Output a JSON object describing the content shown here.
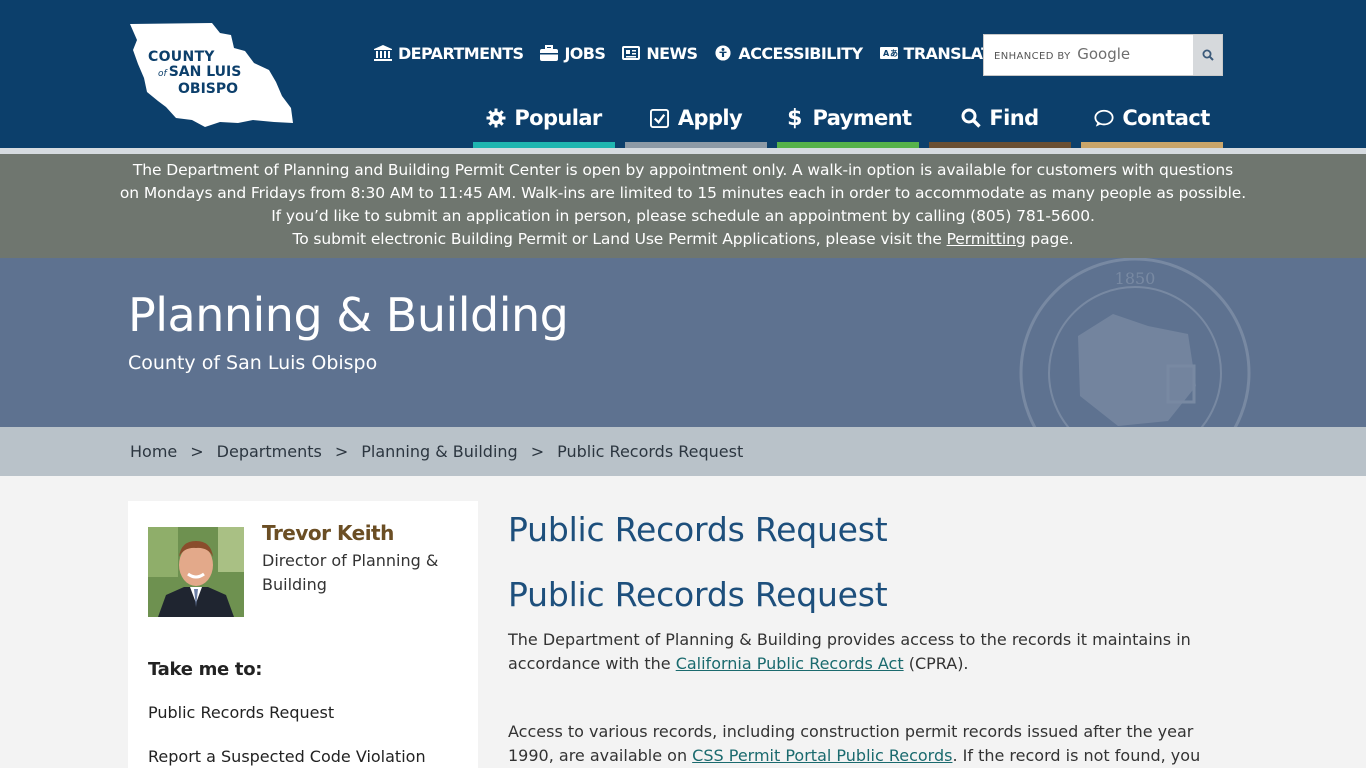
{
  "logo": {
    "line1": "COUNTY",
    "of": "of",
    "line2": "SAN LUIS",
    "line3": "OBISPO"
  },
  "utility_nav": [
    {
      "label": "DEPARTMENTS",
      "icon": "building-icon"
    },
    {
      "label": "JOBS",
      "icon": "briefcase-icon"
    },
    {
      "label": "NEWS",
      "icon": "newspaper-icon"
    },
    {
      "label": "ACCESSIBILITY",
      "icon": "accessibility-icon"
    },
    {
      "label": "TRANSLATE",
      "icon": "translate-icon"
    }
  ],
  "search": {
    "brand_prefix": "ENHANCED BY",
    "brand_name": "Google",
    "placeholder": ""
  },
  "main_nav": [
    {
      "label": "Popular",
      "icon": "gear-icon",
      "color": "#1fb5b0"
    },
    {
      "label": "Apply",
      "icon": "checkbox-icon",
      "color": "#8d9aa6"
    },
    {
      "label": "Payment",
      "icon": "dollar-icon",
      "color": "#56b24a"
    },
    {
      "label": "Find",
      "icon": "search-icon",
      "color": "#6a4f33"
    },
    {
      "label": "Contact",
      "icon": "chat-icon",
      "color": "#c9a56a"
    }
  ],
  "alert": {
    "line1": "The Department of Planning and Building Permit Center is open by appointment only. A walk-in option is available for customers with questions",
    "line2": "on Mondays and Fridays from 8:30 AM to 11:45 AM. Walk-ins are limited to 15 minutes each in order to accommodate as many people as possible.",
    "line3": "If you’d like to submit an application in person, please schedule an appointment by calling (805) 781-5600.",
    "line4_pre": "To submit electronic Building Permit or Land Use Permit Applications, please visit the ",
    "line4_link": "Permitting",
    "line4_post": " page."
  },
  "hero": {
    "title": "Planning & Building",
    "subtitle": "County of San Luis Obispo",
    "seal_year": "1850"
  },
  "breadcrumb": {
    "items": [
      "Home",
      "Departments",
      "Planning & Building",
      "Public Records Request"
    ],
    "separator": ">"
  },
  "sidebar": {
    "person_name": "Trevor Keith",
    "person_role": "Director of Planning & Building",
    "take_me_to": "Take me to:",
    "links": [
      "Public Records Request",
      "Report a Suspected Code Violation"
    ]
  },
  "content": {
    "page_title": "Public Records Request",
    "section_title": "Public Records Request",
    "p1_pre": "The Department of Planning & Building provides access to the records it maintains in accordance with the ",
    "p1_link": "California Public Records Act",
    "p1_post": " (CPRA).",
    "p2_pre": "Access to various records, including construction permit records issued after the year 1990, are available on ",
    "p2_link": "CSS Permit Portal Public Records",
    "p2_post": ". If the record is not found, you may submit"
  }
}
